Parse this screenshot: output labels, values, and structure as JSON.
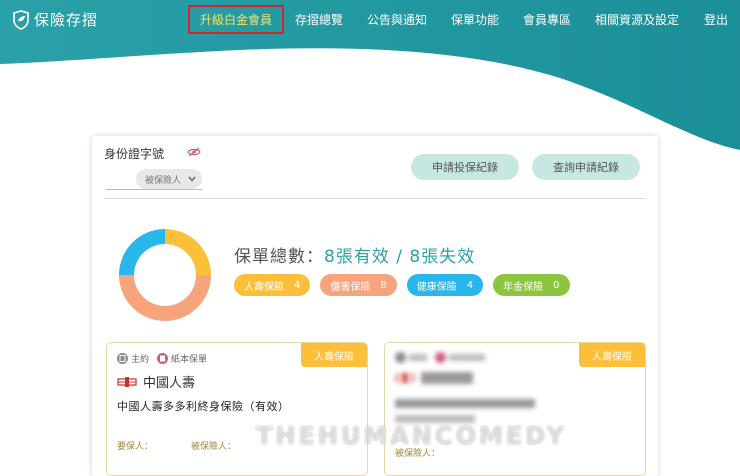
{
  "app": {
    "title": "保險存摺"
  },
  "nav": {
    "upgrade": "升級白金會員",
    "items": [
      "存摺總覽",
      "公告與通知",
      "保單功能",
      "會員專區",
      "相關資源及設定",
      "登出"
    ]
  },
  "panel": {
    "id_label": "身份證字號",
    "role_select": "被保險人",
    "btn_apply_record": "申請投保紀錄",
    "btn_query_record": "查詢申請紀錄"
  },
  "summary": {
    "prefix": "保單總數：",
    "valid": "8張有效",
    "separator": " / ",
    "invalid": "8張失效"
  },
  "donut_data": {
    "values": [
      4,
      8,
      4,
      0
    ],
    "colors": [
      "#fbbf3a",
      "#f7a47d",
      "#29b6ea",
      "#8cc63f"
    ]
  },
  "categories": [
    {
      "label": "人壽保險",
      "count": "4",
      "color": "#fbbf3a"
    },
    {
      "label": "傷害保險",
      "count": "8",
      "color": "#f7a47d"
    },
    {
      "label": "健康保險",
      "count": "4",
      "color": "#29b6ea"
    },
    {
      "label": "年金保險",
      "count": "0",
      "color": "#8cc63f"
    }
  ],
  "policies": [
    {
      "tag": "人壽保險",
      "chip_main": "主約",
      "chip_paper": "紙本保單",
      "company": "中國人壽",
      "product": "中國人壽多多利終身保險（有效）",
      "applicant_label": "要保人：",
      "insured_label": "被保險人："
    },
    {
      "tag": "人壽保險",
      "insured_label": "被保險人："
    }
  ],
  "colors": {
    "teal": "#2ba3a6",
    "accent": "#f3e36a",
    "highlight_border": "#d9232b"
  },
  "watermark": "THEHUMANCOMEDY"
}
